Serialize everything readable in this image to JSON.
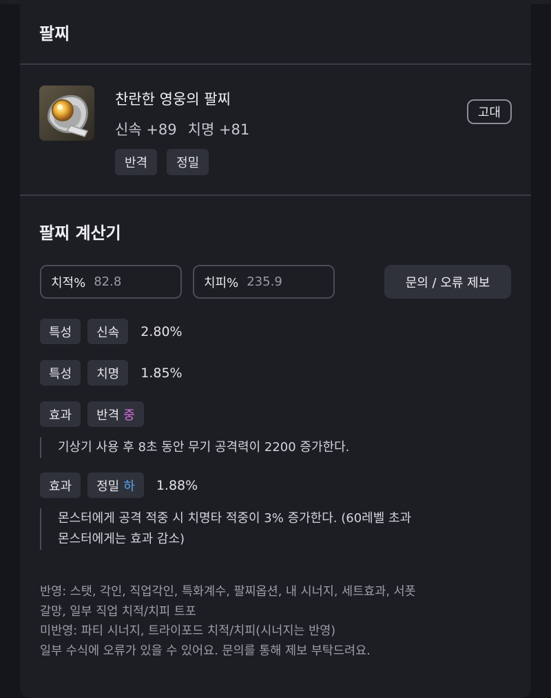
{
  "header": {
    "title": "팔찌"
  },
  "item": {
    "name": "찬란한 영웅의 팔찌",
    "stats": [
      "신속 +89",
      "치명 +81"
    ],
    "tags": [
      "반격",
      "정밀"
    ],
    "grade": "고대",
    "icon": "bracelet-item-icon"
  },
  "calculator": {
    "title": "팔찌 계산기",
    "crit_rate": {
      "label": "치적%",
      "value": "82.8"
    },
    "crit_damage": {
      "label": "치피%",
      "value": "235.9"
    },
    "report_button": "문의 / 오류 제보",
    "rows": [
      {
        "kind": "특성",
        "name": "신속",
        "value": "2.80%"
      },
      {
        "kind": "특성",
        "name": "치명",
        "value": "1.85%"
      }
    ],
    "effects": [
      {
        "kind": "효과",
        "name": "반격",
        "level": "중",
        "level_color": "#d86fe3",
        "value": "",
        "description": [
          "기상기 사용 후 8초 동안 무기 공격력이 2200 증가한다."
        ]
      },
      {
        "kind": "효과",
        "name": "정밀",
        "level": "하",
        "level_color": "#55a6f2",
        "value": "1.88%",
        "description": [
          "몬스터에게 공격 적중 시 치명타 적중이 3% 증가한다. (60레벨 초과",
          "몬스터에게는 효과 감소)"
        ]
      }
    ],
    "notes": [
      "반영: 스탯, 각인, 직업각인, 특화계수, 팔찌옵션, 내 시너지, 세트효과, 서폿",
      "갈망, 일부 직업 치적/치피 트포",
      "미반영: 파티 시너지, 트라이포드 치적/치피(시너지는 반영)",
      "일부 수식에 오류가 있을 수 있어요. 문의를 통해 제보 부탁드려요."
    ]
  }
}
